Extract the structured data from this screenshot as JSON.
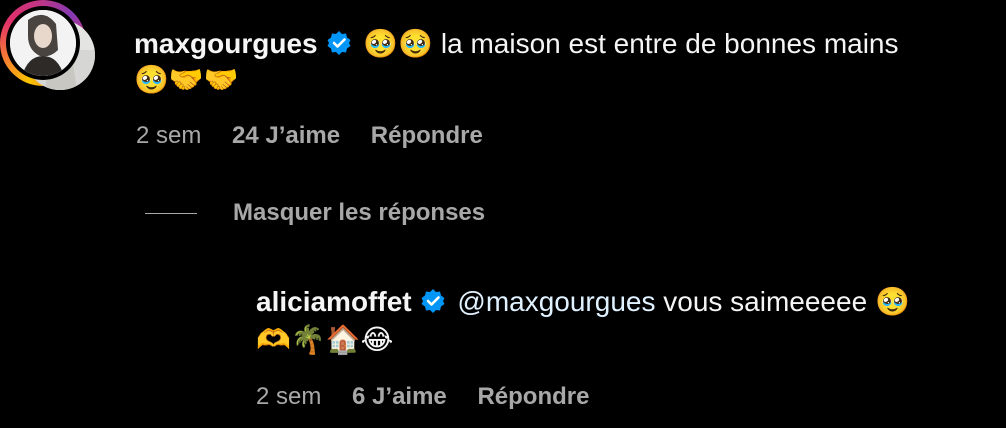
{
  "comment": {
    "username": "maxgourgues",
    "verified": true,
    "text_line1_emoji": "🥹🥹",
    "text_line1": "la maison est entre de bonnes mains",
    "text_line2_emoji": "🥹🤝🤝",
    "time": "2 sem",
    "likes": "24 J’aime",
    "reply_label": "Répondre"
  },
  "hide_replies_label": "Masquer les réponses",
  "reply": {
    "username": "aliciamoffet",
    "verified": true,
    "mention": "@maxgourgues",
    "text": "vous saimeeeee",
    "text_emoji_inline": "🥹",
    "text_line2_emoji": "🫶🌴🏠😂",
    "time": "2 sem",
    "likes": "6 J’aime",
    "reply_label": "Répondre"
  },
  "colors": {
    "background": "#000000",
    "text": "#f5f5f5",
    "meta": "#a8a8a8",
    "verified_badge": "#0095f6",
    "mention": "#e0f1ff"
  },
  "icons": [
    "verified-badge-icon",
    "avatar",
    "story-ring"
  ]
}
